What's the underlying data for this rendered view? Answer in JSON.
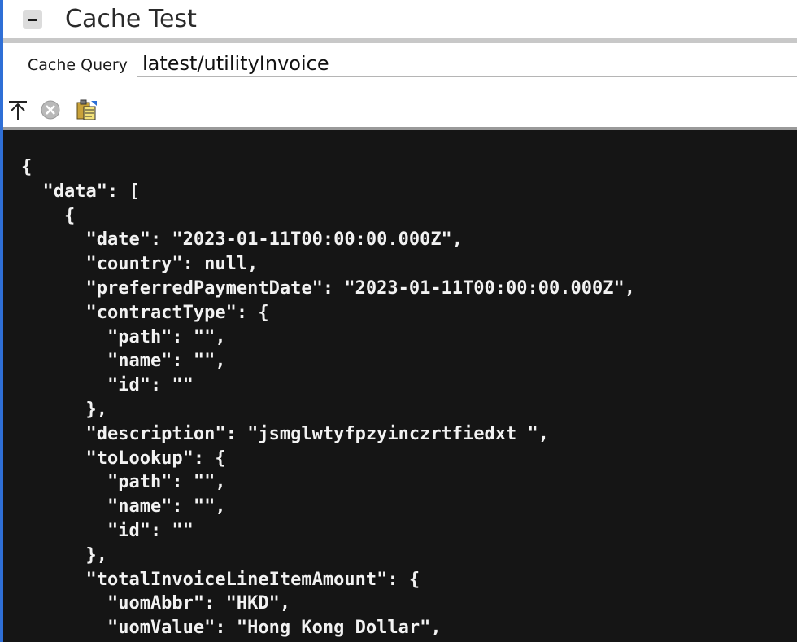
{
  "window": {
    "title": "Cache Test",
    "collapse_icon": "minus-icon"
  },
  "query": {
    "label": "Cache Query",
    "value": "latest/utilityInvoice"
  },
  "toolbar": {
    "icons": [
      "upload-arrow-icon",
      "cancel-circle-icon",
      "clipboard-paste-icon"
    ]
  },
  "editor": {
    "background": "#151515",
    "text_color": "#f2f2f2",
    "lines": [
      "{",
      "  \"data\": [",
      "    {",
      "      \"date\": \"2023-01-11T00:00:00.000Z\",",
      "      \"country\": null,",
      "      \"preferredPaymentDate\": \"2023-01-11T00:00:00.000Z\",",
      "      \"contractType\": {",
      "        \"path\": \"\",",
      "        \"name\": \"\",",
      "        \"id\": \"\"",
      "      },",
      "      \"description\": \"jsmglwtyfpzyinczrtfiedxt \",",
      "      \"toLookup\": {",
      "        \"path\": \"\",",
      "        \"name\": \"\",",
      "        \"id\": \"\"",
      "      },",
      "      \"totalInvoiceLineItemAmount\": {",
      "        \"uomAbbr\": \"HKD\",",
      "        \"uomValue\": \"Hong Kong Dollar\","
    ]
  }
}
